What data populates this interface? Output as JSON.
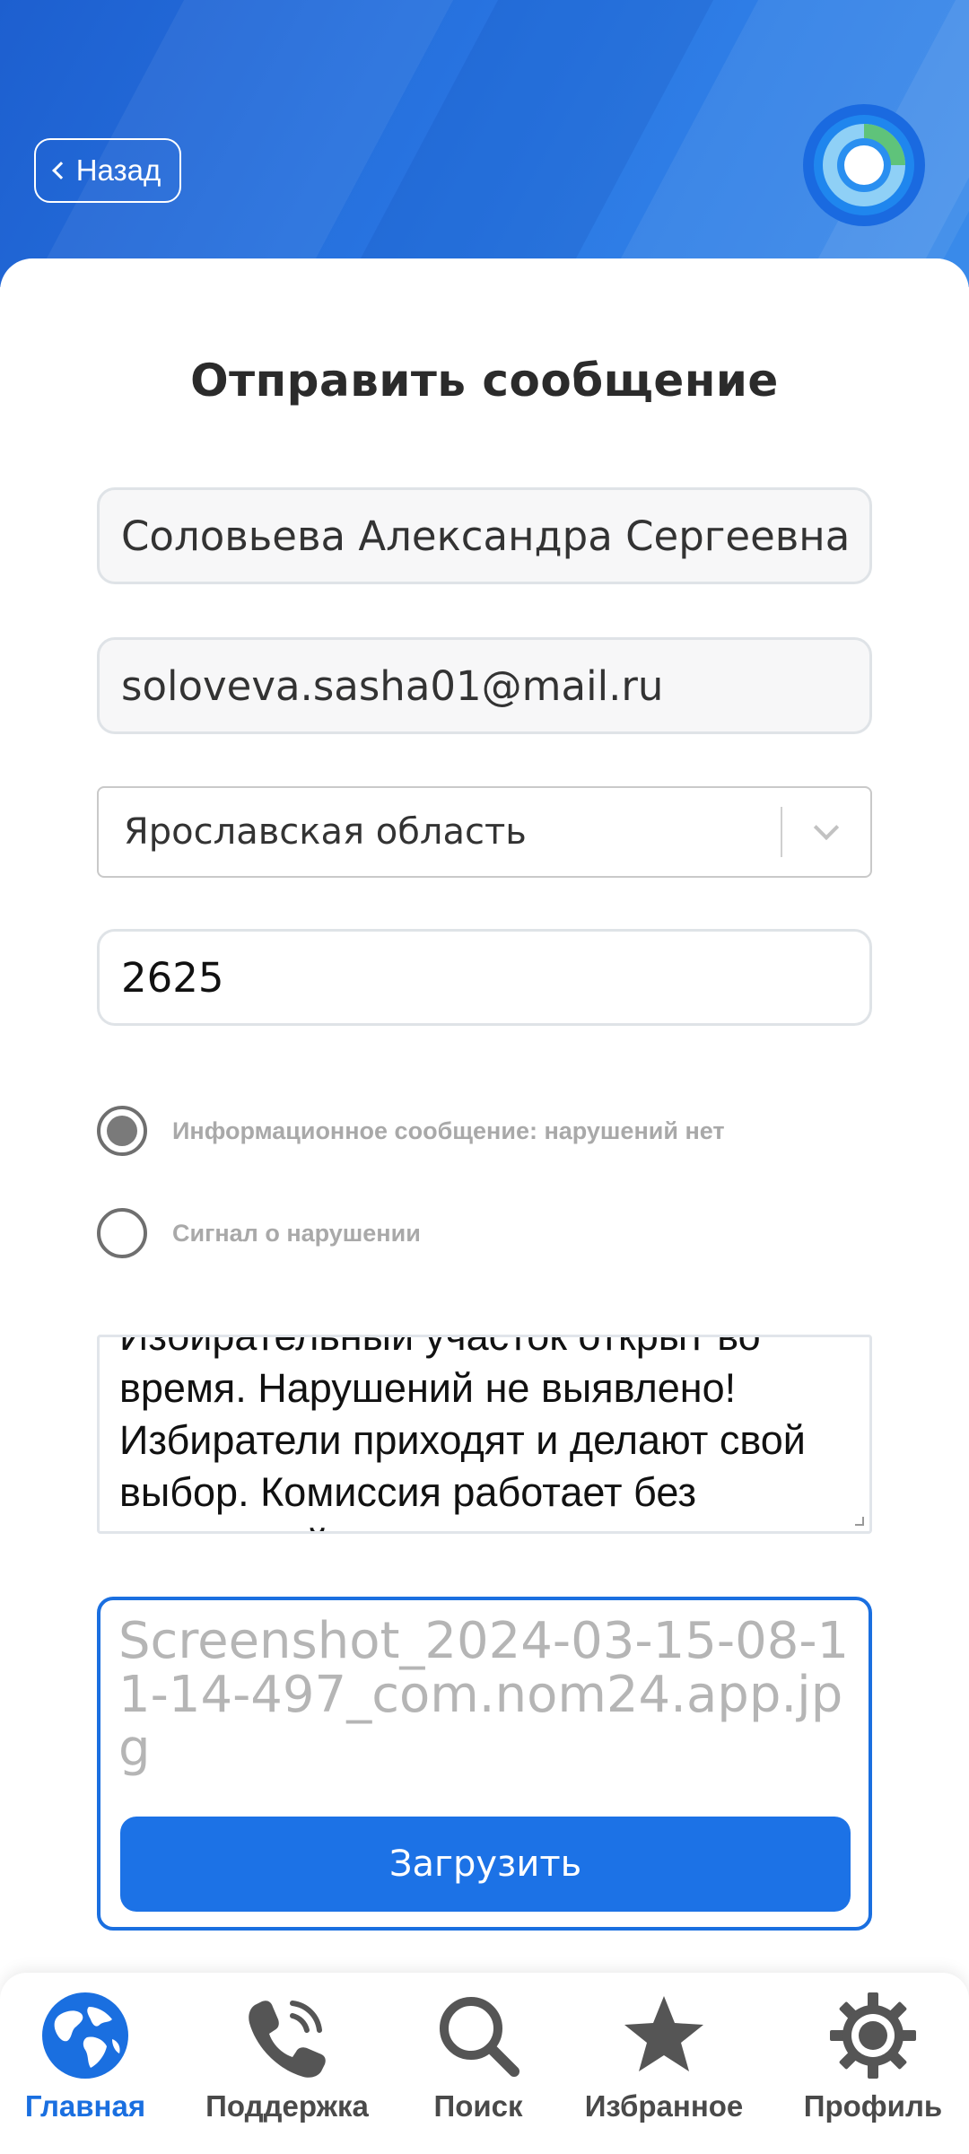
{
  "header": {
    "back_label": "Назад"
  },
  "form": {
    "title": "Отправить сообщение",
    "name_value": "Соловьева Александра Сергеевна",
    "email_value": "soloveva.sasha01@mail.ru",
    "region_selected": "Ярославская область",
    "number_value": "2625",
    "radio_options": [
      {
        "label": "Информационное сообщение: нарушений нет",
        "selected": true
      },
      {
        "label": "Сигнал о нарушении",
        "selected": false
      }
    ],
    "message_text": "Избирательный участок открыт во время. Нарушений не выявлено! Избиратели приходят и делают свой выбор. Комиссия работает без нарушений.",
    "attached_file": "Screenshot_2024-03-15-08-11-14-497_com.nom24.app.jpg",
    "upload_label": "Загрузить"
  },
  "nav": {
    "items": [
      {
        "label": "Главная",
        "icon": "globe-icon",
        "active": true
      },
      {
        "label": "Поддержка",
        "icon": "phone-icon",
        "active": false
      },
      {
        "label": "Поиск",
        "icon": "search-icon",
        "active": false
      },
      {
        "label": "Избранное",
        "icon": "star-icon",
        "active": false
      },
      {
        "label": "Профиль",
        "icon": "gear-icon",
        "active": false
      }
    ]
  },
  "colors": {
    "brand_blue": "#1c72e6",
    "header_blue": "#2a78e4",
    "muted_label": "#a9a9a9",
    "placeholder_gray": "#b5b5b5"
  }
}
